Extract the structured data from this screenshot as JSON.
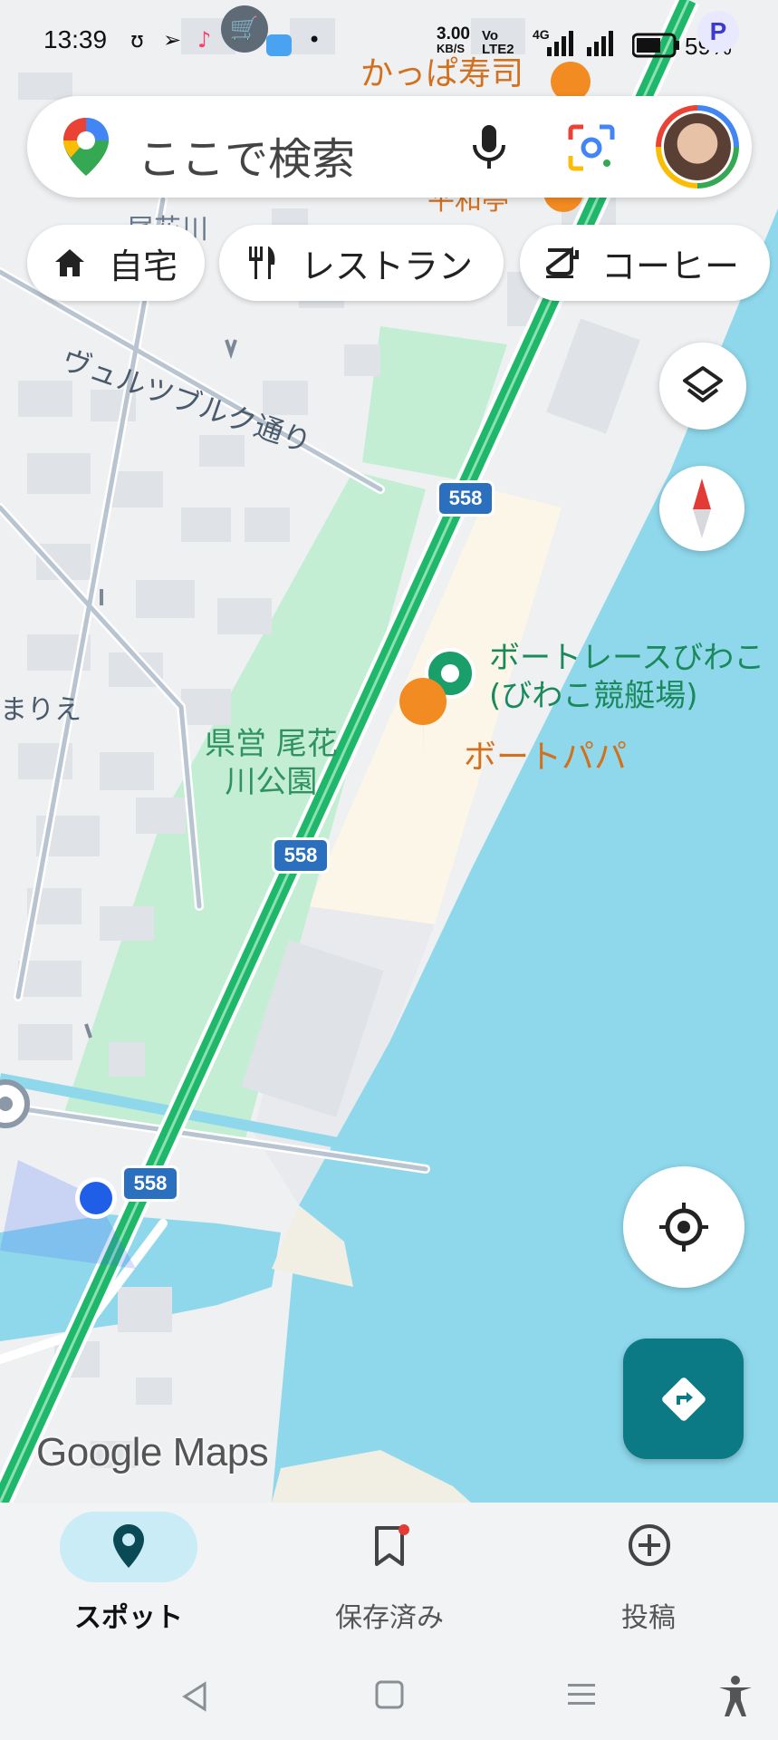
{
  "status_bar": {
    "time": "13:39",
    "net_speed": "3.00",
    "net_unit": "KB/S",
    "net_type": "Vo LTE2",
    "net_gen": "4G",
    "battery": "59%"
  },
  "search": {
    "placeholder": "ここで検索"
  },
  "chips": [
    {
      "label": "自宅",
      "icon": "home-icon"
    },
    {
      "label": "レストラン",
      "icon": "restaurant-icon"
    },
    {
      "label": "コーヒー",
      "icon": "coffee-icon"
    }
  ],
  "map": {
    "street_label": "ヴュルツブルク通り",
    "park_label_1": "県営 尾花",
    "park_label_2": "川公園",
    "place_1_line1": "ボートレースびわこ",
    "place_1_line2": "(びわこ競艇場)",
    "place_2": "ボートパパ",
    "top_place": "かっぱ寿司",
    "top_place_2": "平和亭",
    "area_label": "まりえ",
    "river_label": "尾花川",
    "route_number": "558"
  },
  "branding": {
    "logo": "Google Maps"
  },
  "bottom_nav": {
    "items": [
      {
        "label": "スポット",
        "icon": "location-pin-icon",
        "active": true
      },
      {
        "label": "保存済み",
        "icon": "bookmark-icon",
        "active": false
      },
      {
        "label": "投稿",
        "icon": "add-circle-icon",
        "active": false
      }
    ]
  },
  "colors": {
    "water": "#8fd8ec",
    "park": "#c4eed3",
    "highway": "#1fb86a",
    "accent_teal": "#0b7a85",
    "food_orange": "#f28b22",
    "place_green": "#1a9e6a"
  }
}
